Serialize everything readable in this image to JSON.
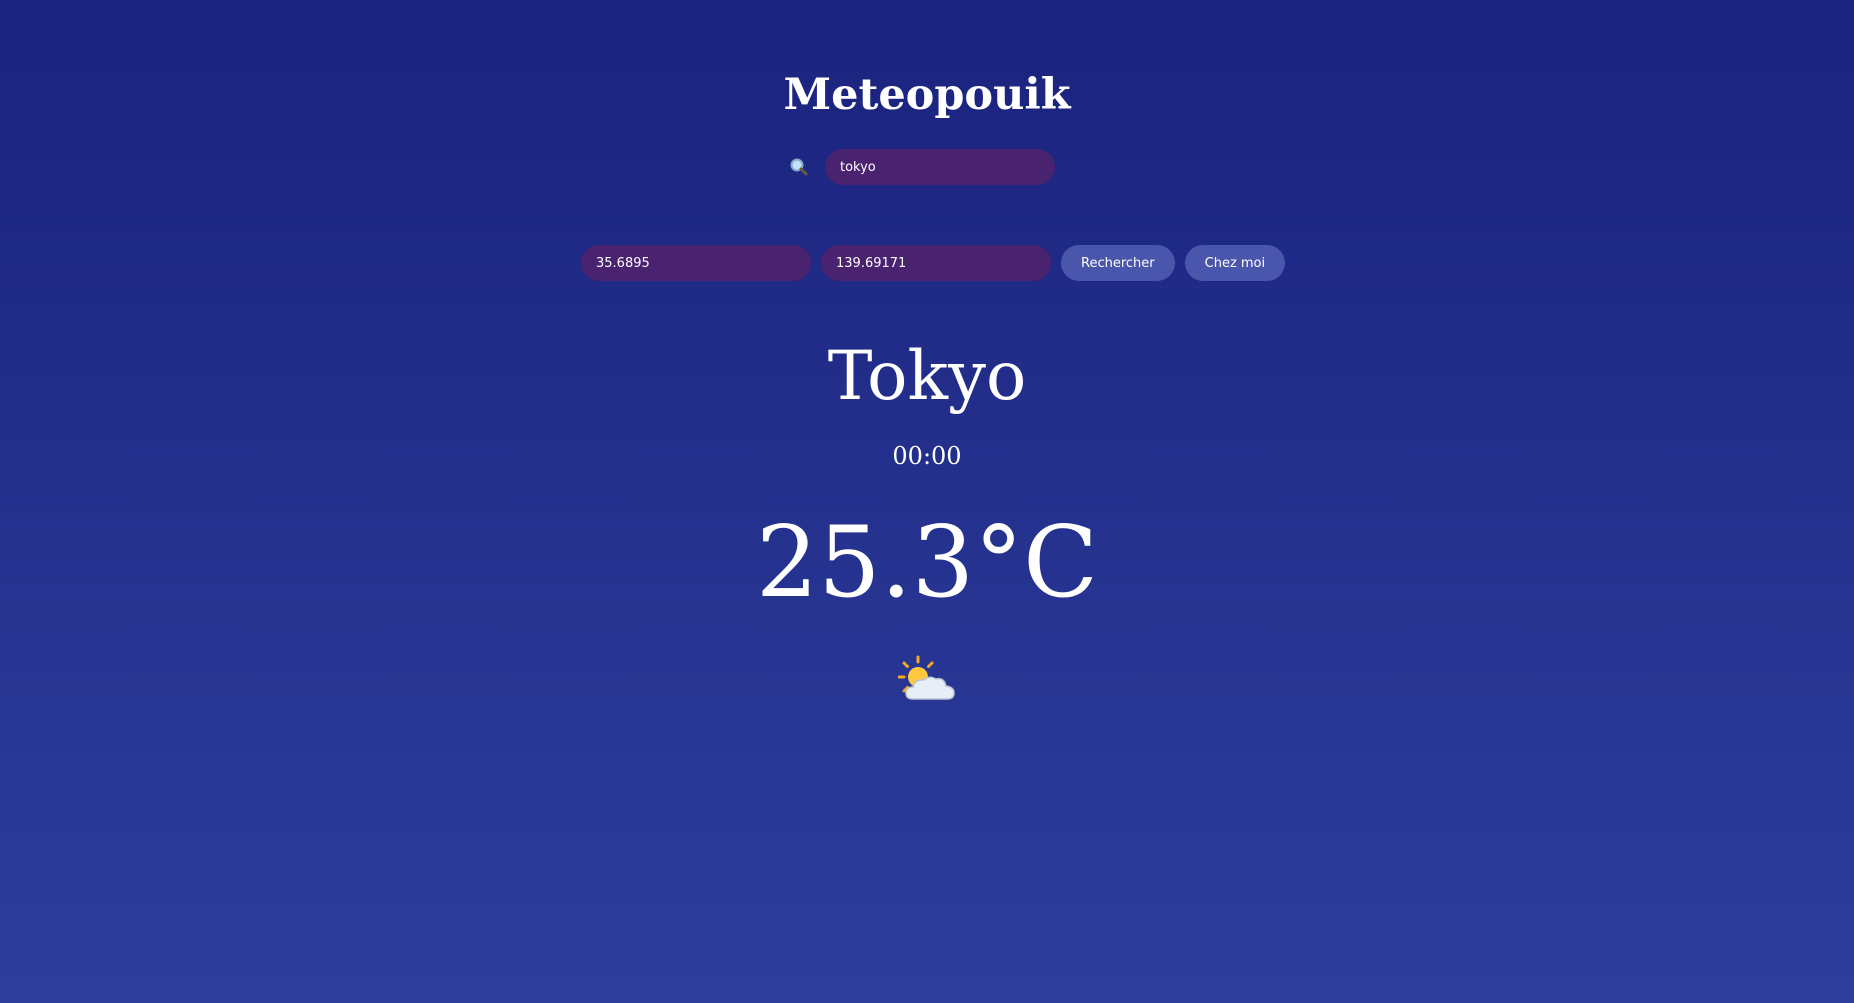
{
  "app": {
    "title": "Meteopouik"
  },
  "search": {
    "icon": "search-icon",
    "city_value": "tokyo"
  },
  "coordinates": {
    "latitude_value": "35.6895",
    "longitude_value": "139.69171",
    "search_button_label": "Rechercher",
    "home_button_label": "Chez moi"
  },
  "weather": {
    "city": "Tokyo",
    "time": "00:00",
    "temperature": "25.3°C",
    "icon": "sun-behind-cloud-icon"
  },
  "colors": {
    "background_top": "#1a237e",
    "background_bottom": "#2e3e9c",
    "input_bg": "#4a2370",
    "button_bg": "#4a55ac",
    "text": "#ffffff"
  }
}
